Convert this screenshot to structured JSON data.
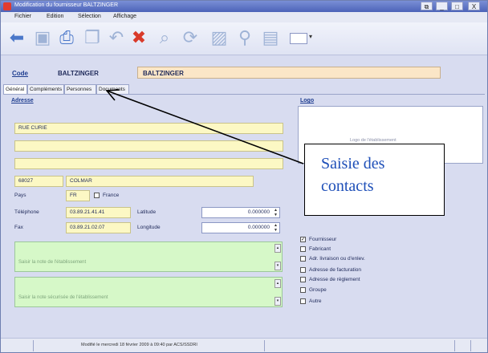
{
  "window": {
    "title": "Modification du fournisseur BALTZINGER",
    "controls": [
      "⧉",
      "_",
      "□",
      "X"
    ]
  },
  "menu": [
    "Fichier",
    "Edition",
    "Sélection",
    "Affichage"
  ],
  "toolbar": {
    "icons": [
      "back-arrow-icon",
      "save-icon",
      "print-icon",
      "copy-icon",
      "undo-icon",
      "delete-icon",
      "zoom-icon",
      "refresh-icon",
      "image-icon",
      "search-icon",
      "list-icon"
    ]
  },
  "header": {
    "code_label": "Code",
    "code_value": "BALTZINGER",
    "name_value": "BALTZINGER"
  },
  "tabs": [
    "Général",
    "Compléments",
    "Personnes",
    "Documents"
  ],
  "address": {
    "title": "Adresse",
    "line1": "RUE CURIE",
    "line2": "",
    "line3": "",
    "postcode": "68027",
    "city": "COLMAR",
    "pays_label": "Pays",
    "pays_code": "FR",
    "pays_name": "France",
    "telephone_label": "Téléphone",
    "telephone": "03.89.21.41.41",
    "fax_label": "Fax",
    "fax": "03.89.21.02.07",
    "latitude_label": "Latitude",
    "latitude": "0.000000",
    "longitude_label": "Longitude",
    "longitude": "0.000000",
    "note_placeholder": "Saisir la note de l'établissement",
    "secure_note_placeholder": "Saisir la note sécurisée de l'établissement"
  },
  "logo": {
    "title": "Logo",
    "caption": "Logo de l'établissement"
  },
  "types": [
    {
      "label": "Fournisseur",
      "checked": true
    },
    {
      "label": "Fabricant",
      "checked": false
    },
    {
      "label": "Adr. livraison ou d'enlev.",
      "checked": false
    },
    {
      "label": "Adresse de facturation",
      "checked": false
    },
    {
      "label": "Adresse de règlement",
      "checked": false
    },
    {
      "label": "Groupe",
      "checked": false
    },
    {
      "label": "Autre",
      "checked": false
    }
  ],
  "callout": {
    "text_line1": "Saisie des",
    "text_line2": "contacts"
  },
  "status": {
    "text": "Modifié le mercredi 18 février 2009 à 09:40 par ACS/SSDRI"
  }
}
